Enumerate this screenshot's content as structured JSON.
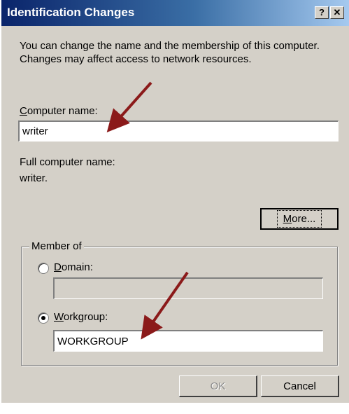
{
  "window": {
    "title": "Identification Changes",
    "help_button": "?",
    "close_button": "✕"
  },
  "description": "You can change the name and the membership of this computer. Changes may affect access to network resources.",
  "computer_name": {
    "label_mnemonic": "C",
    "label_rest": "omputer name:",
    "value": "writer"
  },
  "full_name": {
    "label": "Full computer name:",
    "value": "writer."
  },
  "more_button": {
    "mnemonic": "M",
    "rest": "ore..."
  },
  "member_of": {
    "label": "Member of",
    "domain": {
      "mnemonic": "D",
      "rest": "omain:",
      "value": "",
      "selected": false
    },
    "workgroup": {
      "mnemonic": "W",
      "rest": "orkgroup:",
      "value": "WORKGROUP",
      "selected": true
    }
  },
  "buttons": {
    "ok": "OK",
    "cancel": "Cancel"
  },
  "colors": {
    "annotation_arrow": "#8b1a1a",
    "dialog_bg": "#d4d0c8",
    "title_start": "#0a246a"
  }
}
